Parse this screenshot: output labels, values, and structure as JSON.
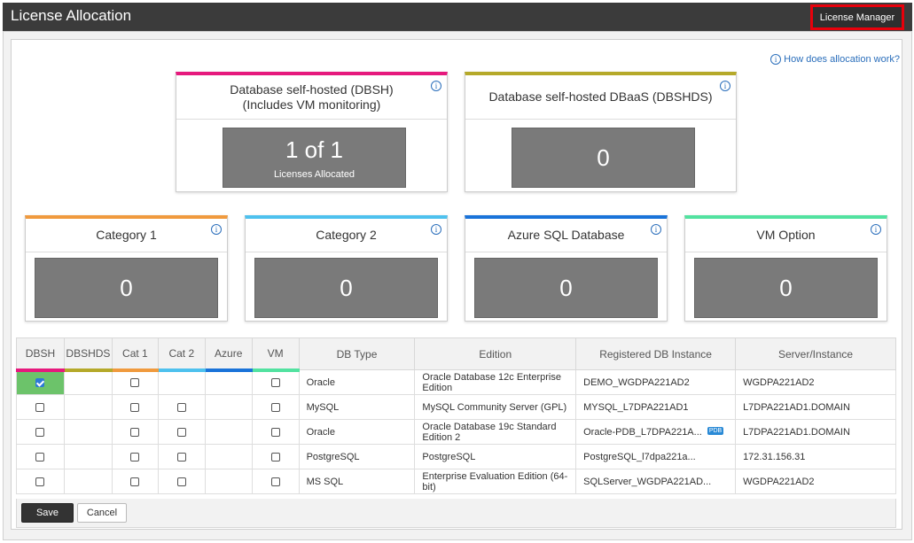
{
  "header": {
    "title": "License Allocation",
    "license_manager": "License Manager"
  },
  "help_link": "How does allocation work?",
  "cards": [
    {
      "id": "dbsh",
      "title_line1": "Database self-hosted (DBSH)",
      "title_line2": "(Includes VM monitoring)",
      "value": "1 of 1",
      "sub": "Licenses Allocated",
      "color": "#e6197d"
    },
    {
      "id": "dbshds",
      "title_line1": "Database self-hosted DBaaS (DBSHDS)",
      "title_line2": "",
      "value": "0",
      "sub": "",
      "color": "#b5a92a"
    },
    {
      "id": "cat1",
      "title_line1": "Category 1",
      "title_line2": "",
      "value": "0",
      "sub": "",
      "color": "#f09a3e"
    },
    {
      "id": "cat2",
      "title_line1": "Category 2",
      "title_line2": "",
      "value": "0",
      "sub": "",
      "color": "#4ec1ee"
    },
    {
      "id": "azure",
      "title_line1": "Azure SQL Database",
      "title_line2": "",
      "value": "0",
      "sub": "",
      "color": "#1a73d9"
    },
    {
      "id": "vm",
      "title_line1": "VM Option",
      "title_line2": "",
      "value": "0",
      "sub": "",
      "color": "#52e2a0"
    }
  ],
  "table": {
    "headers": [
      "DBSH",
      "DBSHDS",
      "Cat 1",
      "Cat 2",
      "Azure",
      "VM",
      "DB Type",
      "Edition",
      "Registered DB Instance",
      "Server/Instance"
    ],
    "header_colors": [
      "#e6197d",
      "#b5a92a",
      "#f09a3e",
      "#4ec1ee",
      "#1a73d9",
      "#52e2a0"
    ],
    "rows": [
      {
        "checks": [
          true,
          null,
          false,
          null,
          null,
          false
        ],
        "db_type": "Oracle",
        "edition": "Oracle Database 12c Enterprise Edition",
        "instance": "DEMO_WGDPA221AD2",
        "pdb": false,
        "server": "WGDPA221AD2"
      },
      {
        "checks": [
          false,
          null,
          false,
          false,
          null,
          false
        ],
        "db_type": "MySQL",
        "edition": "MySQL Community Server (GPL)",
        "instance": "MYSQL_L7DPA221AD1",
        "pdb": false,
        "server": "L7DPA221AD1.DOMAIN"
      },
      {
        "checks": [
          false,
          null,
          false,
          false,
          null,
          false
        ],
        "db_type": "Oracle",
        "edition": "Oracle Database 19c Standard Edition 2",
        "instance": "Oracle-PDB_L7DPA221A...",
        "pdb": true,
        "server": "L7DPA221AD1.DOMAIN"
      },
      {
        "checks": [
          false,
          null,
          false,
          false,
          null,
          false
        ],
        "db_type": "PostgreSQL",
        "edition": "PostgreSQL",
        "instance": "PostgreSQL_l7dpa221a...",
        "pdb": false,
        "server": "172.31.156.31"
      },
      {
        "checks": [
          false,
          null,
          false,
          false,
          null,
          false
        ],
        "db_type": "MS SQL",
        "edition": "Enterprise Evaluation Edition (64-bit)",
        "instance": "SQLServer_WGDPA221AD...",
        "pdb": false,
        "server": "WGDPA221AD2"
      }
    ],
    "pdb_label": "PDB"
  },
  "footer": {
    "save": "Save",
    "cancel": "Cancel"
  }
}
